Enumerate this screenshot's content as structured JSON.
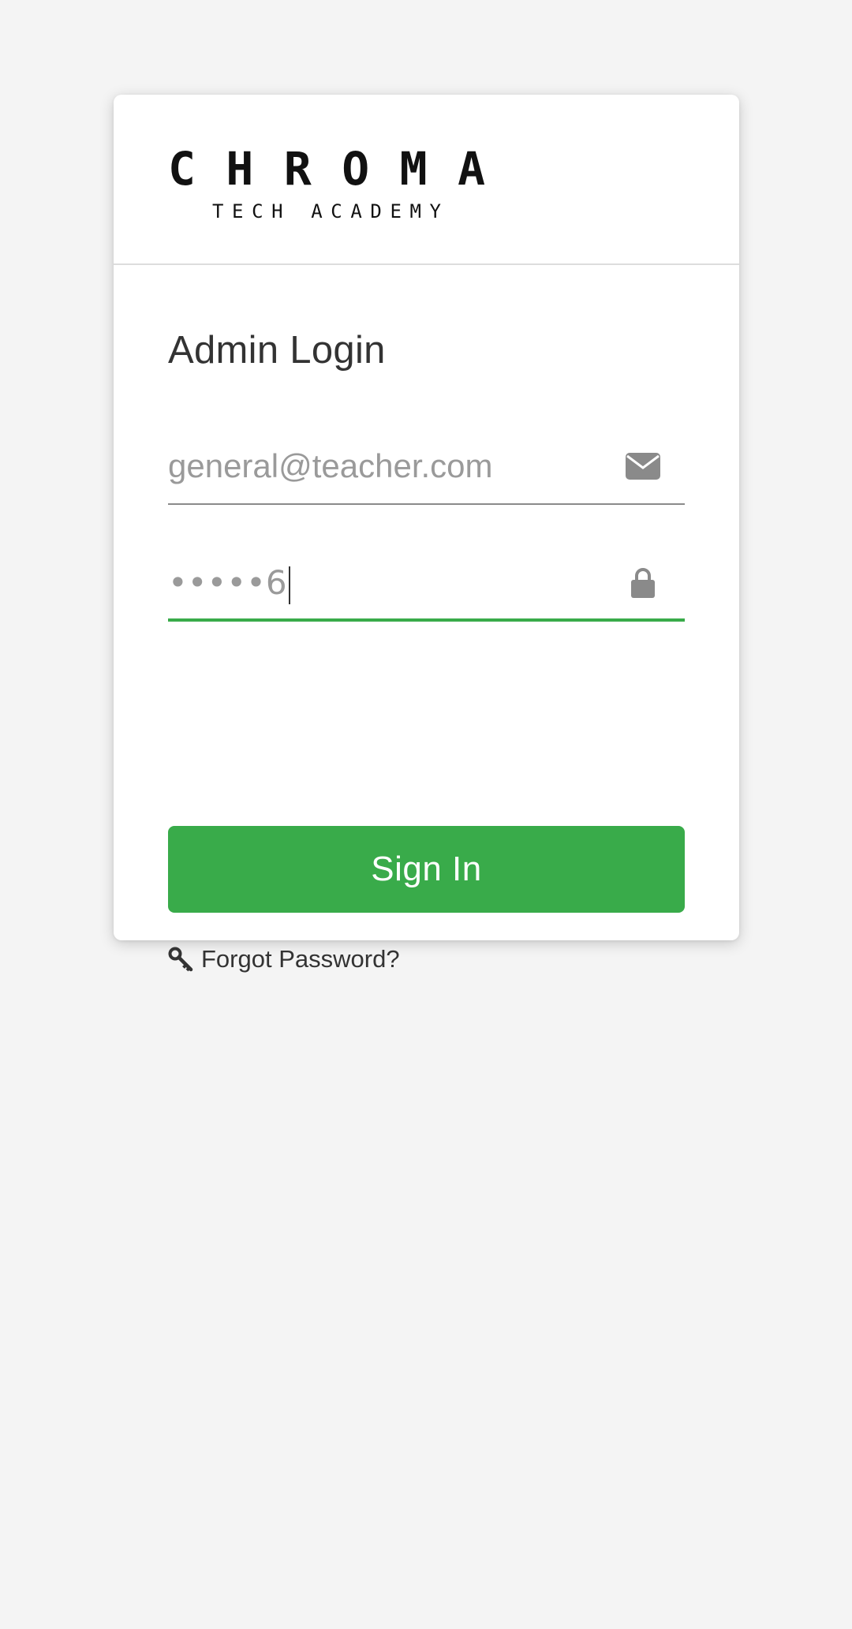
{
  "logo": {
    "brand": "CHROMA",
    "tagline": "TECH ACADEMY"
  },
  "login": {
    "title": "Admin Login",
    "email": {
      "placeholder": "general@teacher.com",
      "icon": "envelope-icon"
    },
    "password": {
      "value": "•••••6",
      "icon": "lock-icon"
    },
    "signin_label": "Sign In",
    "forgot_label": "Forgot Password?",
    "forgot_icon": "key-icon"
  },
  "colors": {
    "accent": "#39ab4a",
    "background": "#f4f4f4",
    "text": "#333333",
    "muted": "#9a9a9a"
  }
}
